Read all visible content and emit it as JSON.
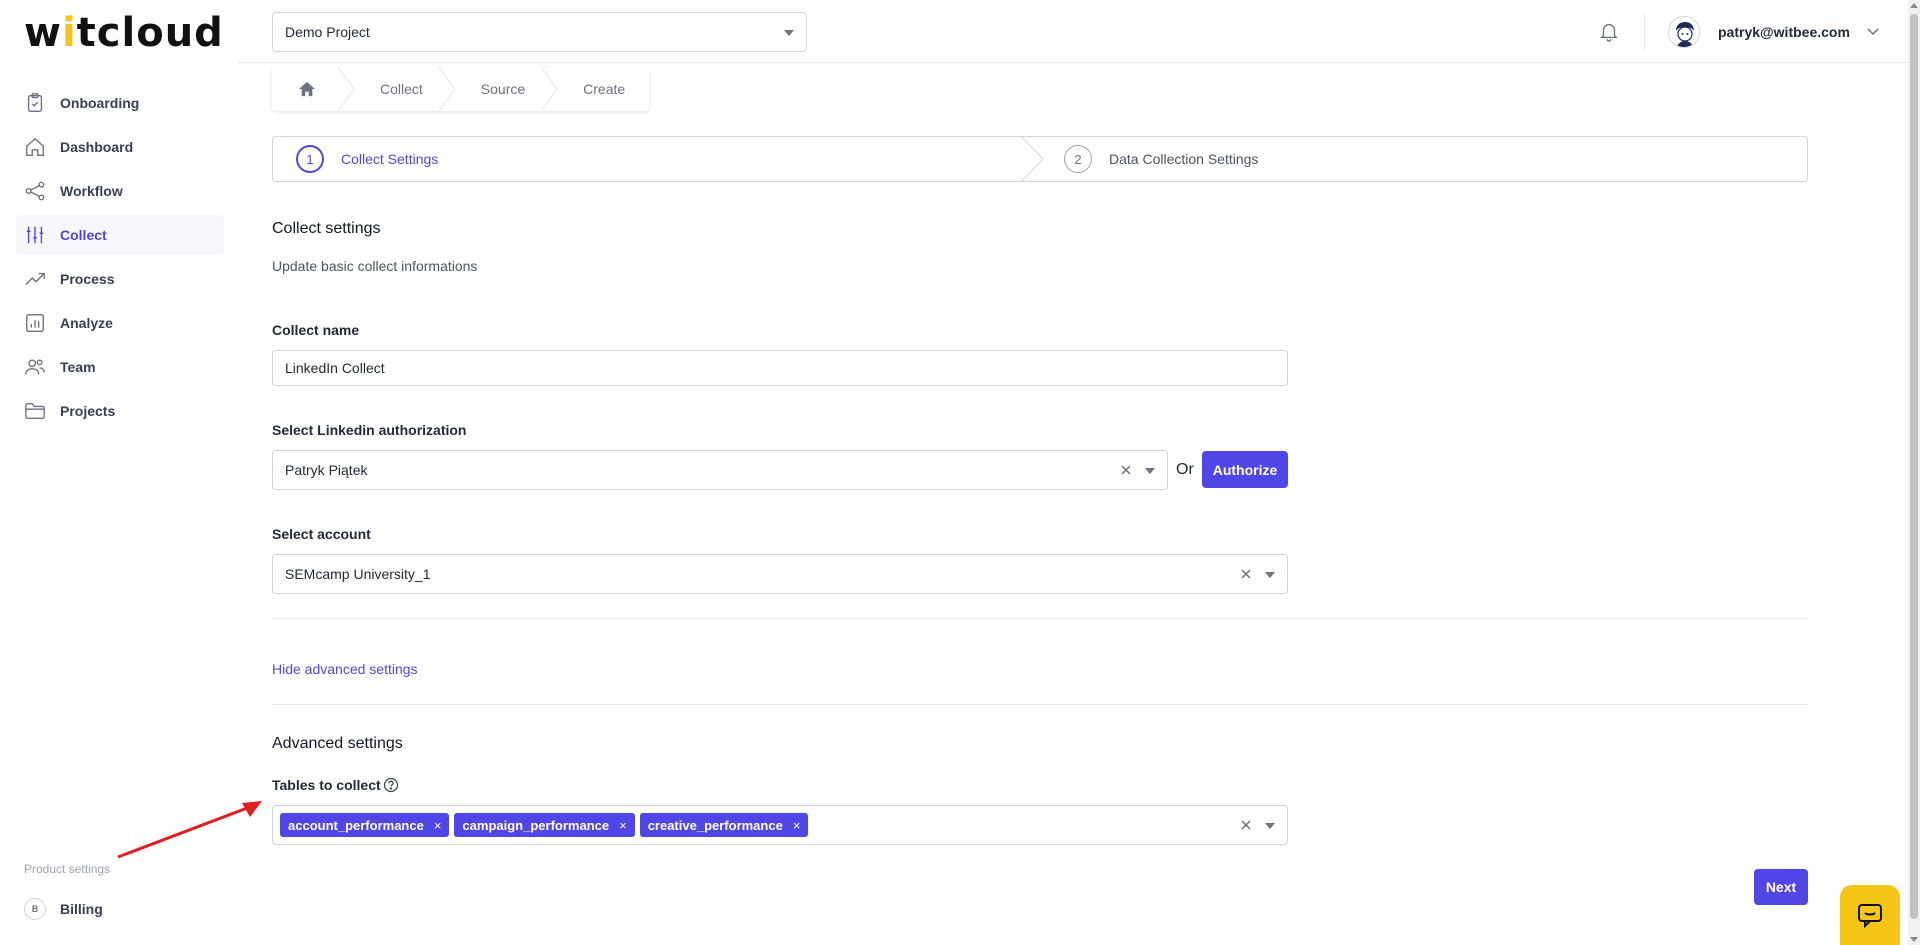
{
  "brand": {
    "logo_pre": "w",
    "logo_accent": "i",
    "logo_mid": "t",
    "logo_post": "cloud",
    "accent_color": "#f5c518",
    "primary_color": "#4f46e5"
  },
  "sidebar": {
    "items": [
      {
        "label": "Onboarding",
        "icon": "clipboard-check-icon"
      },
      {
        "label": "Dashboard",
        "icon": "home-icon"
      },
      {
        "label": "Workflow",
        "icon": "share-nodes-icon"
      },
      {
        "label": "Collect",
        "icon": "sliders-icon",
        "active": true
      },
      {
        "label": "Process",
        "icon": "trend-up-icon"
      },
      {
        "label": "Analyze",
        "icon": "bar-chart-icon"
      },
      {
        "label": "Team",
        "icon": "users-icon"
      },
      {
        "label": "Projects",
        "icon": "folder-icon"
      }
    ],
    "product_settings_label": "Product settings",
    "billing_badge": "B",
    "billing_label": "Billing"
  },
  "header": {
    "project": "Demo Project",
    "user_email": "patryk@witbee.com"
  },
  "breadcrumb": [
    "Collect",
    "Source",
    "Create"
  ],
  "stepper": {
    "steps": [
      {
        "num": "1",
        "label": "Collect Settings",
        "active": true
      },
      {
        "num": "2",
        "label": "Data Collection Settings",
        "active": false
      }
    ]
  },
  "form": {
    "title": "Collect settings",
    "description": "Update basic collect informations",
    "collect_name_label": "Collect name",
    "collect_name_value": "LinkedIn Collect",
    "auth_label": "Select Linkedin authorization",
    "auth_value": "Patryk Piątek",
    "or_text": "Or",
    "authorize_button": "Authorize",
    "account_label": "Select account",
    "account_value": "SEMcamp University_1",
    "toggle_advanced": "Hide advanced settings",
    "advanced_title": "Advanced settings",
    "tables_label": "Tables to collect",
    "tables": [
      "account_performance",
      "campaign_performance",
      "creative_performance"
    ],
    "tag_remove_glyph": "×",
    "next_button": "Next"
  }
}
